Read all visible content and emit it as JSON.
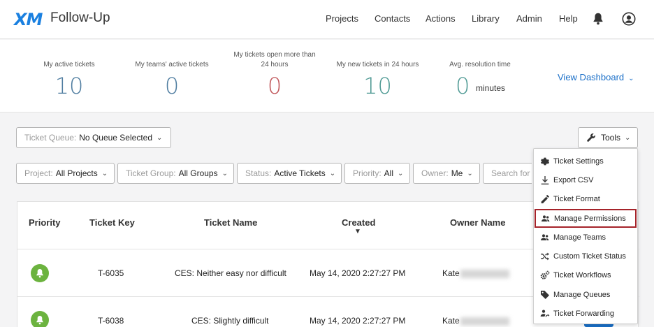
{
  "header": {
    "logo": "XM",
    "title": "Follow-Up",
    "nav": [
      "Projects",
      "Contacts",
      "Actions",
      "Library",
      "Admin",
      "Help"
    ]
  },
  "stats": {
    "items": [
      {
        "label": "My active tickets",
        "value": "10",
        "color": "#4f7da0"
      },
      {
        "label": "My teams' active tickets",
        "value": "0",
        "color": "#4f7da0"
      },
      {
        "label": "My tickets open more than 24 hours",
        "value": "0",
        "color": "#c0565a"
      },
      {
        "label": "My new tickets in 24 hours",
        "value": "10",
        "color": "#4f9a94"
      },
      {
        "label": "Avg. resolution time",
        "value": "0",
        "unit": "minutes",
        "color": "#4f9a94"
      }
    ],
    "view_dashboard": "View Dashboard"
  },
  "queue": {
    "label": "Ticket Queue:",
    "value": "No Queue Selected"
  },
  "tools": {
    "label": "Tools"
  },
  "filters": {
    "project": {
      "label": "Project:",
      "value": "All Projects"
    },
    "group": {
      "label": "Ticket Group:",
      "value": "All Groups"
    },
    "status": {
      "label": "Status:",
      "value": "Active Tickets"
    },
    "priority": {
      "label": "Priority:",
      "value": "All"
    },
    "owner": {
      "label": "Owner:",
      "value": "Me"
    },
    "search_placeholder": "Search for"
  },
  "table": {
    "headers": {
      "priority": "Priority",
      "key": "Ticket Key",
      "name": "Ticket Name",
      "created": "Created",
      "owner": "Owner Name"
    },
    "sort_indicator": "▼",
    "rows": [
      {
        "key": "T-6035",
        "name": "CES: Neither easy nor difficult",
        "created": "May 14, 2020 2:27:27 PM",
        "owner": "Kate"
      },
      {
        "key": "T-6038",
        "name": "CES: Slightly difficult",
        "created": "May 14, 2020 2:27:27 PM",
        "owner": "Kate"
      }
    ]
  },
  "tools_menu": {
    "items": [
      {
        "label": "Ticket Settings",
        "icon": "gear-icon"
      },
      {
        "label": "Export CSV",
        "icon": "download-icon"
      },
      {
        "label": "Ticket Format",
        "icon": "pencil-icon"
      },
      {
        "label": "Manage Permissions",
        "icon": "users-icon",
        "highlighted": true
      },
      {
        "label": "Manage Teams",
        "icon": "users-icon"
      },
      {
        "label": "Custom Ticket Status",
        "icon": "shuffle-icon"
      },
      {
        "label": "Ticket Workflows",
        "icon": "gears-icon"
      },
      {
        "label": "Manage Queues",
        "icon": "tags-icon"
      },
      {
        "label": "Ticket Forwarding",
        "icon": "user-forward-icon"
      }
    ],
    "highlight_color": "#a5232a"
  }
}
